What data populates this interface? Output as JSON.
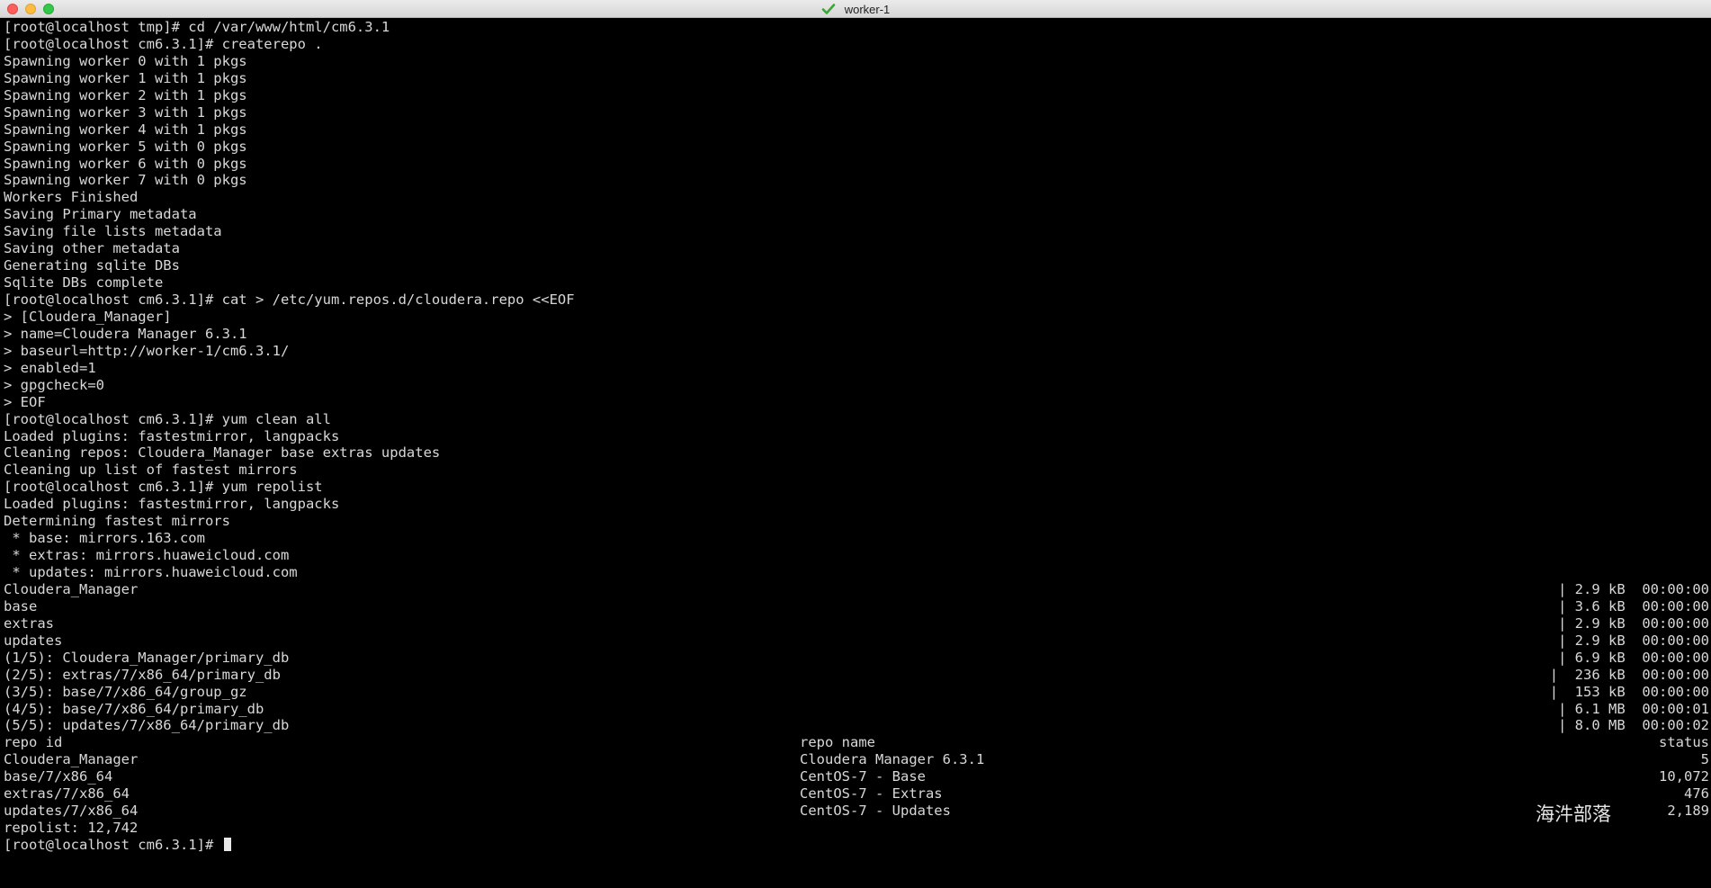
{
  "window": {
    "title": "worker-1",
    "title_icon": "green-checkmark-icon",
    "buttons": [
      "close",
      "minimize",
      "maximize"
    ],
    "colors": {
      "background": "#000000",
      "text": "#d8d8d8",
      "titlebar": "#e2e2e2"
    }
  },
  "terminal": {
    "lines": [
      "[root@localhost tmp]# cd /var/www/html/cm6.3.1",
      "[root@localhost cm6.3.1]# createrepo .",
      "Spawning worker 0 with 1 pkgs",
      "Spawning worker 1 with 1 pkgs",
      "Spawning worker 2 with 1 pkgs",
      "Spawning worker 3 with 1 pkgs",
      "Spawning worker 4 with 1 pkgs",
      "Spawning worker 5 with 0 pkgs",
      "Spawning worker 6 with 0 pkgs",
      "Spawning worker 7 with 0 pkgs",
      "Workers Finished",
      "Saving Primary metadata",
      "Saving file lists metadata",
      "Saving other metadata",
      "Generating sqlite DBs",
      "Sqlite DBs complete",
      "[root@localhost cm6.3.1]# cat > /etc/yum.repos.d/cloudera.repo <<EOF",
      "> [Cloudera_Manager]",
      "> name=Cloudera Manager 6.3.1",
      "> baseurl=http://worker-1/cm6.3.1/",
      "> enabled=1",
      "> gpgcheck=0",
      "> EOF",
      "[root@localhost cm6.3.1]# yum clean all",
      "Loaded plugins: fastestmirror, langpacks",
      "Cleaning repos: Cloudera_Manager base extras updates",
      "Cleaning up list of fastest mirrors",
      "[root@localhost cm6.3.1]# yum repolist",
      "Loaded plugins: fastestmirror, langpacks",
      "Determining fastest mirrors",
      " * base: mirrors.163.com",
      " * extras: mirrors.huaweicloud.com",
      " * updates: mirrors.huaweicloud.com"
    ],
    "downloads": [
      {
        "name": "Cloudera_Manager",
        "progress": "| 2.9 kB  00:00:00"
      },
      {
        "name": "base",
        "progress": "| 3.6 kB  00:00:00"
      },
      {
        "name": "extras",
        "progress": "| 2.9 kB  00:00:00"
      },
      {
        "name": "updates",
        "progress": "| 2.9 kB  00:00:00"
      },
      {
        "name": "(1/5): Cloudera_Manager/primary_db",
        "progress": "| 6.9 kB  00:00:00"
      },
      {
        "name": "(2/5): extras/7/x86_64/primary_db",
        "progress": "|  236 kB  00:00:00"
      },
      {
        "name": "(3/5): base/7/x86_64/group_gz",
        "progress": "|  153 kB  00:00:00"
      },
      {
        "name": "(4/5): base/7/x86_64/primary_db",
        "progress": "| 6.1 MB  00:00:01"
      },
      {
        "name": "(5/5): updates/7/x86_64/primary_db",
        "progress": "| 8.0 MB  00:00:02"
      }
    ],
    "repo_table": {
      "headers": {
        "id": "repo id",
        "name": "repo name",
        "status": "status"
      },
      "rows": [
        {
          "id": "Cloudera_Manager",
          "name": "Cloudera Manager 6.3.1",
          "status": "5"
        },
        {
          "id": "base/7/x86_64",
          "name": "CentOS-7 - Base",
          "status": "10,072"
        },
        {
          "id": "extras/7/x86_64",
          "name": "CentOS-7 - Extras",
          "status": "476"
        },
        {
          "id": "updates/7/x86_64",
          "name": "CentOS-7 - Updates",
          "status": "2,189"
        }
      ]
    },
    "repolist_summary": "repolist: 12,742",
    "prompt": "[root@localhost cm6.3.1]# "
  },
  "watermark": "海汼部落"
}
